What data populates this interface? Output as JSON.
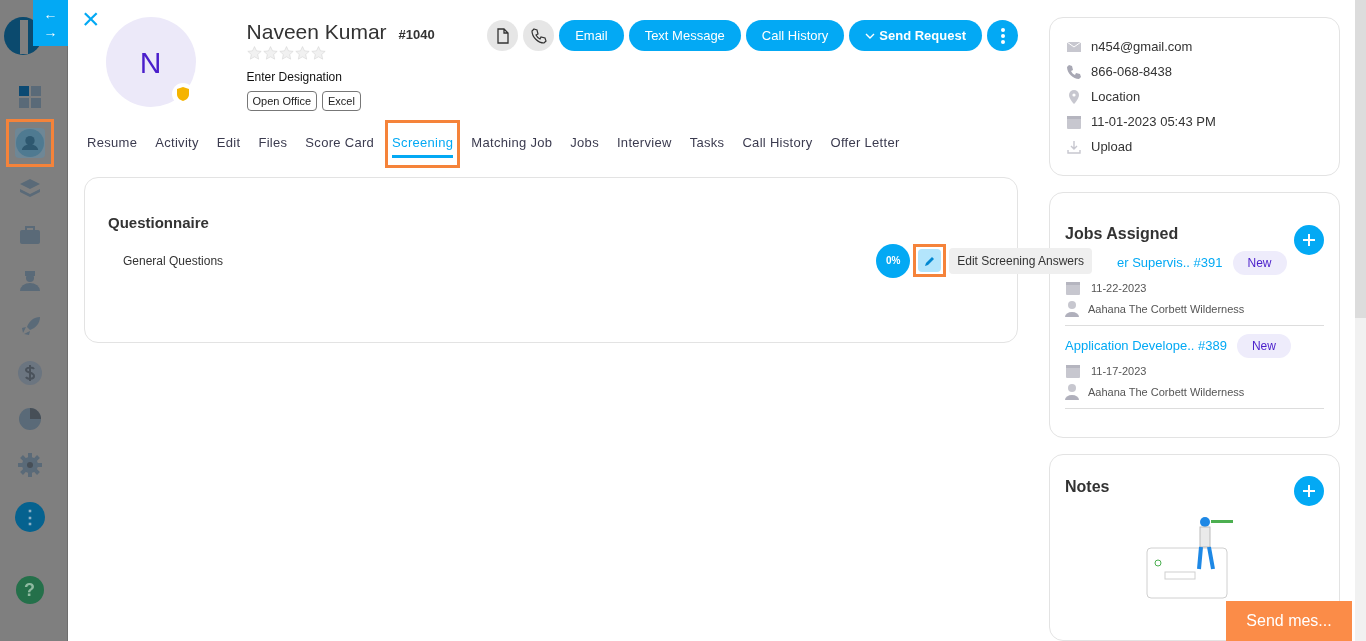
{
  "nav_arrows": [
    "←",
    "→"
  ],
  "sidebar": {
    "items": [
      {
        "kind": "dashboard",
        "selected": false,
        "highlighted": false
      },
      {
        "kind": "user",
        "selected": true,
        "highlighted": true
      },
      {
        "kind": "layers",
        "selected": false,
        "highlighted": false
      },
      {
        "kind": "briefcase",
        "selected": false,
        "highlighted": false
      },
      {
        "kind": "agent",
        "selected": false,
        "highlighted": false
      },
      {
        "kind": "rocket",
        "selected": false,
        "highlighted": false
      },
      {
        "kind": "dollar",
        "selected": false,
        "highlighted": false
      },
      {
        "kind": "chart",
        "selected": false,
        "highlighted": false
      },
      {
        "kind": "settings",
        "selected": false,
        "highlighted": false
      }
    ],
    "more_button": "⋮",
    "help_button": "?"
  },
  "close_button": "×",
  "profile": {
    "initial": "N",
    "name": "Naveen Kumar",
    "id": "#1040",
    "stars": 0,
    "designation": "Enter Designation",
    "tags": [
      "Open Office",
      "Excel"
    ]
  },
  "actions": [
    {
      "kind": "file"
    },
    {
      "kind": "phone"
    },
    {
      "kind": "button",
      "label": "Email"
    },
    {
      "kind": "button",
      "label": "Text Message"
    },
    {
      "kind": "button",
      "label": "Call History"
    },
    {
      "kind": "dropdown",
      "label": "Send Request"
    },
    {
      "kind": "more"
    }
  ],
  "tabs": [
    {
      "label": "Resume",
      "selected": false,
      "highlighted": false
    },
    {
      "label": "Activity",
      "selected": false,
      "highlighted": false
    },
    {
      "label": "Edit",
      "selected": false,
      "highlighted": false
    },
    {
      "label": "Files",
      "selected": false,
      "highlighted": false
    },
    {
      "label": "Score Card",
      "selected": false,
      "highlighted": false
    },
    {
      "label": "Screening",
      "selected": true,
      "highlighted": true
    },
    {
      "label": "Matching Job",
      "selected": false,
      "highlighted": false
    },
    {
      "label": "Jobs",
      "selected": false,
      "highlighted": false
    },
    {
      "label": "Interview",
      "selected": false,
      "highlighted": false
    },
    {
      "label": "Tasks",
      "selected": false,
      "highlighted": false
    },
    {
      "label": "Call History",
      "selected": false,
      "highlighted": false
    },
    {
      "label": "Offer Letter",
      "selected": false,
      "highlighted": false
    }
  ],
  "questionnaire": {
    "title": "Questionnaire",
    "sections": [
      {
        "name": "General Questions",
        "progress": "0%",
        "edit_highlighted": true,
        "tooltip": "Edit Screening Answers"
      }
    ]
  },
  "contact": [
    {
      "kind": "email",
      "text": "n454@gmail.com"
    },
    {
      "kind": "phone",
      "text": "866-068-8438"
    },
    {
      "kind": "location",
      "text": "Location"
    },
    {
      "kind": "date",
      "text": "11-01-2023 05:43 PM"
    },
    {
      "kind": "upload",
      "text": "Upload"
    }
  ],
  "jobs_assigned": {
    "title": "Jobs Assigned",
    "jobs": [
      {
        "title": "er Supervis.. #391",
        "status": "New",
        "date": "11-22-2023",
        "owner": "Aahana The Corbett Wilderness"
      },
      {
        "title": "Application Develope.. #389",
        "status": "New",
        "date": "11-17-2023",
        "owner": "Aahana The Corbett Wilderness"
      }
    ]
  },
  "notes": {
    "title": "Notes"
  },
  "send_message_button": "Send mes..."
}
